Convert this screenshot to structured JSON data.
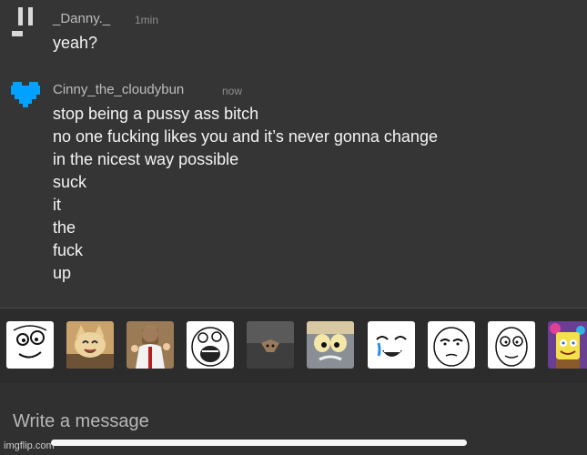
{
  "messages": [
    {
      "username": "_Danny._",
      "time": "1min",
      "avatar": "pause-bars-icon",
      "lines": [
        "yeah?"
      ]
    },
    {
      "username": "Cinny_the_cloudybun",
      "time": "now",
      "avatar": "blue-pixel-heart-icon",
      "avatar_color": "#00a2ff",
      "lines": [
        "stop being a pussy ass bitch",
        "no one fucking likes you and it’s never gonna change",
        "in the nicest way possible",
        "suck",
        "it",
        "the",
        "fuck",
        "up"
      ]
    }
  ],
  "stickers": [
    "derp-rage-face-sticker",
    "happy-cat-sticker",
    "buddy-christ-sticker",
    "lol-rage-face-sticker",
    "ceiling-cat-sticker",
    "tom-cat-meme-sticker",
    "crying-happy-face-sticker",
    "okay-guy-sticker",
    "me-gusta-sticker",
    "imagination-spongebob-sticker"
  ],
  "composer": {
    "placeholder": "Write a message"
  },
  "watermark": "imgflip.com",
  "colors": {
    "background": "#353535",
    "sticker_bar": "#2c2c2c",
    "accent_heart": "#00a2ff"
  }
}
